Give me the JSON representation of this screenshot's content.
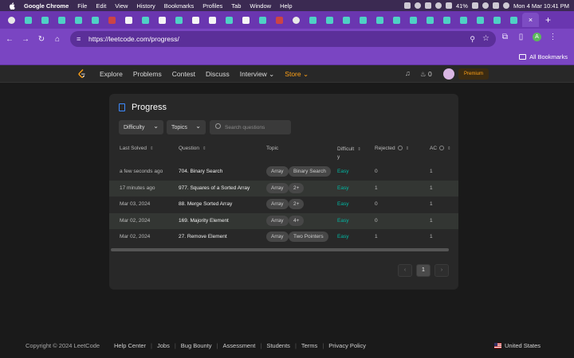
{
  "mac_menubar": {
    "app": "Google Chrome",
    "menus": [
      "File",
      "Edit",
      "View",
      "History",
      "Bookmarks",
      "Profiles",
      "Tab",
      "Window",
      "Help"
    ],
    "battery": "41%",
    "datetime": "Mon 4 Mar  10:41 PM"
  },
  "chrome": {
    "tab_favicons": [
      "chrome-icon",
      "leetcode-icon",
      "leetcode-icon",
      "leetcode-icon",
      "leetcode-icon",
      "leetcode-icon",
      "other-icon",
      "wiki-icon",
      "leetcode-icon",
      "wiki-icon",
      "leetcode-icon",
      "wiki-icon",
      "wiki-icon",
      "leetcode-icon",
      "wiki-icon",
      "leetcode-icon",
      "other-icon",
      "chrome-icon",
      "leetcode-icon",
      "leetcode-icon",
      "leetcode-icon",
      "leetcode-icon",
      "leetcode-icon",
      "leetcode-icon",
      "leetcode-icon",
      "leetcode-icon",
      "leetcode-icon",
      "leetcode-icon",
      "leetcode-icon",
      "leetcode-icon",
      "leetcode-icon"
    ],
    "tab_close": "×",
    "new_tab": "+",
    "url": "https://leetcode.com/progress/",
    "profile_initial": "A",
    "all_bookmarks": "All Bookmarks",
    "colors": {
      "tabstrip": "#6a36b0",
      "toolbar": "#7a45c2",
      "omnibox": "#5b2f99"
    }
  },
  "lc_nav": {
    "links": [
      "Explore",
      "Problems",
      "Contest",
      "Discuss"
    ],
    "interview": "Interview ⌄",
    "store": "Store ⌄",
    "streak": "0",
    "premium": "Premium",
    "colors": {
      "accent": "#ffa116",
      "easy": "#00b8a3"
    }
  },
  "progress": {
    "title": "Progress",
    "filters": {
      "difficulty": "Difficulty",
      "topics": "Topics"
    },
    "search_placeholder": "Search questions",
    "headers": {
      "last_solved": "Last Solved",
      "question": "Question",
      "topic": "Topic",
      "difficulty_l1": "Difficult",
      "difficulty_l2": "y",
      "rejected": "Rejected",
      "ac": "AC"
    },
    "rows": [
      {
        "last_solved": "a few seconds ago",
        "question": "704. Binary Search",
        "topics": [
          "Array",
          "Binary Search"
        ],
        "difficulty": "Easy",
        "rejected": "0",
        "ac": "1"
      },
      {
        "last_solved": "17 minutes ago",
        "question": "977. Squares of a Sorted Array",
        "topics": [
          "Array",
          "2+"
        ],
        "difficulty": "Easy",
        "rejected": "1",
        "ac": "1"
      },
      {
        "last_solved": "Mar 03, 2024",
        "question": "88. Merge Sorted Array",
        "topics": [
          "Array",
          "2+"
        ],
        "difficulty": "Easy",
        "rejected": "0",
        "ac": "1"
      },
      {
        "last_solved": "Mar 02, 2024",
        "question": "169. Majority Element",
        "topics": [
          "Array",
          "4+"
        ],
        "difficulty": "Easy",
        "rejected": "0",
        "ac": "1"
      },
      {
        "last_solved": "Mar 02, 2024",
        "question": "27. Remove Element",
        "topics": [
          "Array",
          "Two Pointers"
        ],
        "difficulty": "Easy",
        "rejected": "1",
        "ac": "1"
      }
    ],
    "pagination": {
      "prev": "‹",
      "current": "1",
      "next": "›"
    }
  },
  "footer": {
    "copyright": "Copyright © 2024 LeetCode",
    "links": [
      "Help Center",
      "Jobs",
      "Bug Bounty",
      "Assessment",
      "Students",
      "Terms",
      "Privacy Policy"
    ],
    "region": "United States"
  }
}
